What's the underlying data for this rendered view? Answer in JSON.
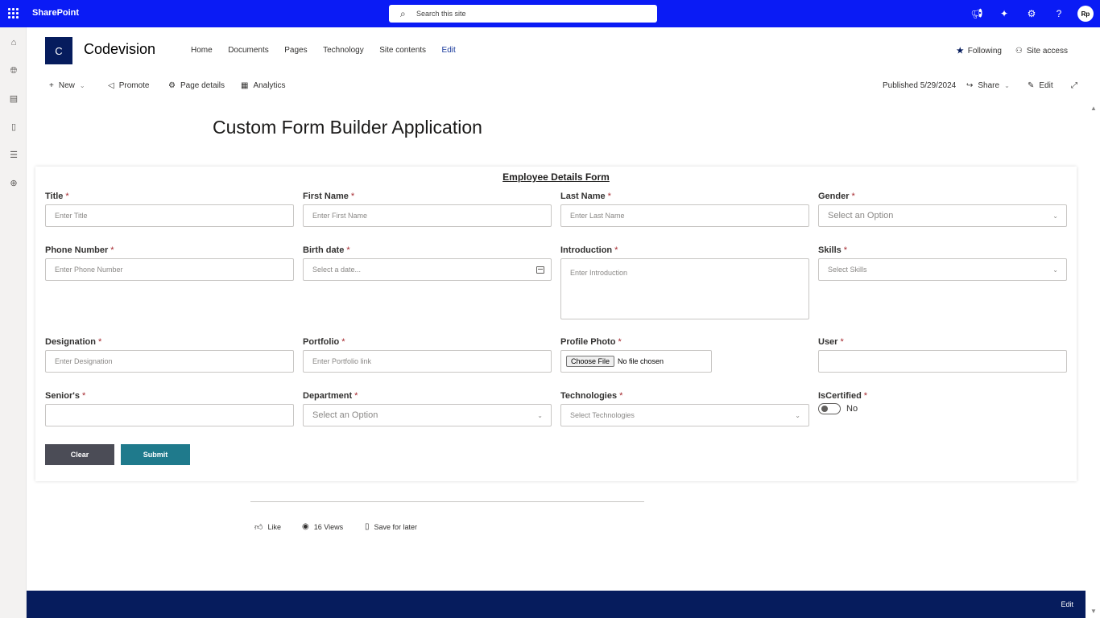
{
  "topbar": {
    "brand": "SharePoint",
    "search_placeholder": "Search this site",
    "user_initials": "Rp"
  },
  "site": {
    "logo_letter": "C",
    "name": "Codevision",
    "nav": [
      "Home",
      "Documents",
      "Pages",
      "Technology",
      "Site contents",
      "Edit"
    ],
    "following": "Following",
    "site_access": "Site access"
  },
  "commandbar": {
    "new": "New",
    "promote": "Promote",
    "page_details": "Page details",
    "analytics": "Analytics",
    "published": "Published 5/29/2024",
    "share": "Share",
    "edit": "Edit"
  },
  "page": {
    "title": "Custom Form Builder Application"
  },
  "form": {
    "title": "Employee Details Form",
    "required_mark": "*",
    "title_label": "Title",
    "title_placeholder": "Enter Title",
    "first_name_label": "First Name",
    "first_name_placeholder": "Enter First Name",
    "last_name_label": "Last Name",
    "last_name_placeholder": "Enter Last Name",
    "gender_label": "Gender",
    "gender_value": "Select an Option",
    "phone_label": "Phone Number",
    "phone_placeholder": "Enter Phone Number",
    "birth_label": "Birth date",
    "birth_placeholder": "Select a date...",
    "intro_label": "Introduction",
    "intro_placeholder": "Enter Introduction",
    "skills_label": "Skills",
    "skills_placeholder": "Select Skills",
    "designation_label": "Designation",
    "designation_placeholder": "Enter Designation",
    "portfolio_label": "Portfolio",
    "portfolio_placeholder": "Enter Portfolio link",
    "photo_label": "Profile Photo",
    "photo_button": "Choose File",
    "photo_status": "No file chosen",
    "user_label": "User",
    "seniors_label": "Senior's",
    "department_label": "Department",
    "department_value": "Select an Option",
    "technologies_label": "Technologies",
    "technologies_placeholder": "Select Technologies",
    "certified_label": "IsCertified",
    "certified_value": "No",
    "clear_button": "Clear",
    "submit_button": "Submit",
    "clear_color": "#4b4c56",
    "submit_color": "#1f7a8c"
  },
  "social": {
    "like": "Like",
    "views": "16 Views",
    "save": "Save for later"
  },
  "footer": {
    "edit": "Edit"
  },
  "colors": {
    "topbar": "#0a1bf5",
    "footer": "#061c5d"
  }
}
